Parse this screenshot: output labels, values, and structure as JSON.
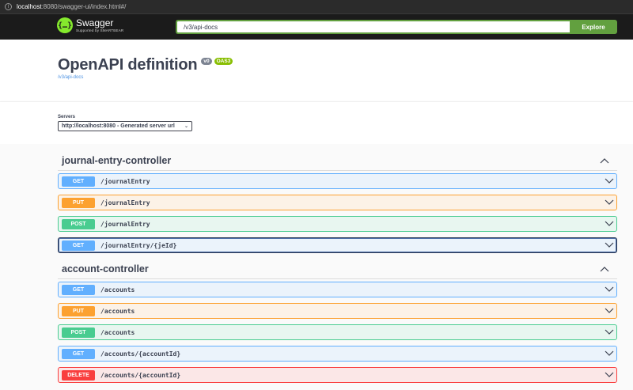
{
  "browser": {
    "url_host": "localhost",
    "url_rest": ":8080/swagger-ui/index.html#/"
  },
  "topbar": {
    "logo_name": "Swagger",
    "logo_sub": "Supported by SMARTBEAR",
    "logo_glyph": "{…}",
    "url_value": "/v3/api-docs",
    "explore_label": "Explore"
  },
  "info": {
    "title": "OpenAPI definition",
    "version": "v0",
    "oas": "OAS3",
    "link": "/v3/api-docs"
  },
  "servers": {
    "label": "Servers",
    "selected": "http://localhost:8080 - Generated server url"
  },
  "tags": [
    {
      "name": "journal-entry-controller",
      "operations": [
        {
          "method": "GET",
          "path": "/journalEntry"
        },
        {
          "method": "PUT",
          "path": "/journalEntry"
        },
        {
          "method": "POST",
          "path": "/journalEntry"
        },
        {
          "method": "GET",
          "path": "/journalEntry/{jeId}"
        }
      ]
    },
    {
      "name": "account-controller",
      "operations": [
        {
          "method": "GET",
          "path": "/accounts"
        },
        {
          "method": "PUT",
          "path": "/accounts"
        },
        {
          "method": "POST",
          "path": "/accounts"
        },
        {
          "method": "GET",
          "path": "/accounts/{accountId}"
        },
        {
          "method": "DELETE",
          "path": "/accounts/{accountId}"
        }
      ]
    }
  ],
  "colors": {
    "get": "#61affe",
    "put": "#fca130",
    "post": "#49cc90",
    "delete": "#f93e3e",
    "brand_green": "#85ea2d",
    "explore_green": "#62a03f"
  },
  "icons": {
    "op_expand": "chevron-down-icon",
    "tag_collapse": "chevron-up-icon",
    "browser_info": "info-icon"
  }
}
